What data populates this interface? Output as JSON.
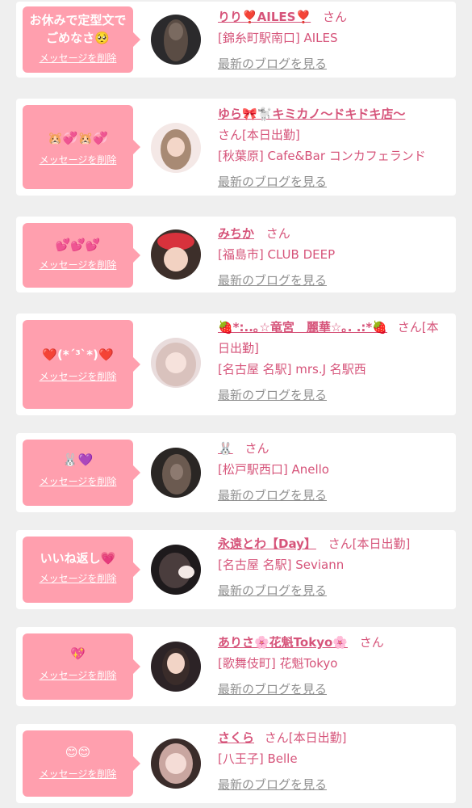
{
  "ui": {
    "delete_label": "メッセージを削除",
    "blog_label": "最新のブログを見る",
    "colors": {
      "bubble": "#ff9fae",
      "accent": "#d6547a",
      "link_gray": "#8f8f8f",
      "background": "#efefef"
    }
  },
  "entries": [
    {
      "message": "お休みで定型文でごめなさ🥺",
      "name": "りり❣️AILES❣️",
      "suffix": "さん",
      "shop": "[錦糸町駅南口] AILES"
    },
    {
      "message": "🐹💞🐹💞",
      "name": "ゆら🎀🐩キミカノ〜ドキドキ店〜",
      "suffix": "さん[本日出勤]",
      "shop": "[秋葉原] Cafe&Bar コンカフェランド"
    },
    {
      "message": "💕💕💕",
      "name": "みちか",
      "suffix": "さん",
      "shop": "[福島市] CLUB DEEP"
    },
    {
      "message": "❤️(*´³`*)❤️",
      "name": "🍓*:..｡☆竜宮　麗華☆｡. .:*🍓",
      "suffix": "さん[本日出勤]",
      "shop": "[名古屋 名駅] mrs.J 名駅西"
    },
    {
      "message": "🐰💜",
      "name": "🐰",
      "suffix": "さん",
      "shop": "[松戸駅西口] Anello"
    },
    {
      "message": "いいね返し💗",
      "name": "永遠とわ【Day】",
      "suffix": "さん[本日出勤]",
      "shop": "[名古屋 名駅] Seviann"
    },
    {
      "message": "💖",
      "name": "ありさ🌸花魁Tokyo🌸",
      "suffix": "さん",
      "shop": "[歌舞伎町] 花魁Tokyo"
    },
    {
      "message": "😊😊",
      "name": "さくら",
      "suffix": "さん[本日出勤]",
      "shop": "[八王子] Belle"
    }
  ]
}
